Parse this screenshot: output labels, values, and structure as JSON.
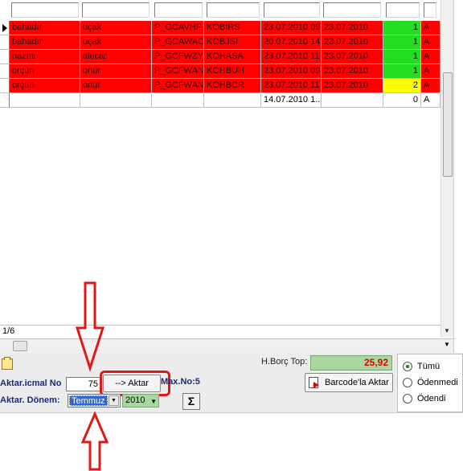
{
  "grid": {
    "rows": [
      {
        "c1": "bahadır",
        "c2": "uçak",
        "c3": "P_GCAVHF",
        "c4": "KOBIRS",
        "c5": "23.07.2010 09",
        "c6": "23.07.2010",
        "c7": "1",
        "c8": "A",
        "style": "red",
        "qty_color": "green",
        "current": true
      },
      {
        "c1": "bahadır",
        "c2": "uçak",
        "c3": "P_GCAWAO",
        "c4": "KOBJSI",
        "c5": "20.07.2010 14",
        "c6": "23.07.2010",
        "c7": "1",
        "c8": "A",
        "style": "red",
        "qty_color": "green",
        "current": false
      },
      {
        "c1": "nazmı",
        "c2": "alucar",
        "c3": "P_GCFWZY",
        "c4": "KOHASA",
        "c5": "23.07.2010 11",
        "c6": "23.07.2010",
        "c7": "1",
        "c8": "A",
        "style": "red",
        "qty_color": "green",
        "current": false
      },
      {
        "c1": "orçun",
        "c2": "onur",
        "c3": "P_GCFWAN",
        "c4": "KOHBUH",
        "c5": "23.07.2010 09",
        "c6": "23.07.2010",
        "c7": "1",
        "c8": "A",
        "style": "red",
        "qty_color": "green",
        "current": false
      },
      {
        "c1": "orçun",
        "c2": "onur",
        "c3": "P_GCFWAN",
        "c4": "KOHBCR",
        "c5": "23.07.2010 11",
        "c6": "23.07.2010",
        "c7": "2",
        "c8": "A",
        "style": "red",
        "qty_color": "yellow",
        "current": false
      },
      {
        "c1": "",
        "c2": "",
        "c3": "",
        "c4": "",
        "c5": "14.07.2010 1...",
        "c6": "",
        "c7": "0",
        "c8": "A",
        "style": "white",
        "qty_color": "white",
        "current": false
      }
    ],
    "page_indicator": "1/6"
  },
  "summary": {
    "hborc_label": "H.Borç Top:",
    "hborc_value": "25,92"
  },
  "form": {
    "icmal_label": "Aktar.icmal No",
    "icmal_value": "75",
    "aktar_button": "-->  Aktar",
    "max_no": "Max.No:5",
    "donem_label": "Aktar. Dönem:",
    "donem_month": "Temmuz",
    "donem_year": "2010",
    "sigma": "Σ",
    "barcode_button": "Barcode'la Aktar"
  },
  "filter": {
    "options": [
      "Tümü",
      "Ödenmedi",
      "Ödendi"
    ],
    "selected": "Tümü"
  },
  "colors": {
    "row_red": "#ff0000",
    "qty_green": "#22dd22",
    "qty_yellow": "#ffff00",
    "hborc_bg": "#a8d8a0",
    "hborc_text": "#e00000",
    "annotation_red": "#e01818"
  }
}
